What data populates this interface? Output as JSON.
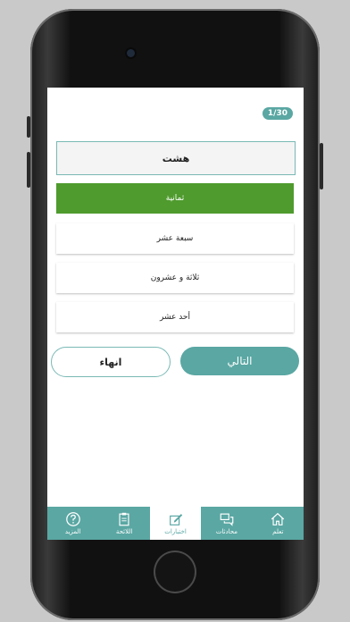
{
  "quiz": {
    "counter": "1/30",
    "question": "هشت",
    "options": [
      {
        "label": "ثمانية",
        "state": "correct"
      },
      {
        "label": "سبعة عشر",
        "state": "default"
      },
      {
        "label": "ثلاثة و عشرون",
        "state": "default"
      },
      {
        "label": "أحد عشر",
        "state": "default"
      }
    ]
  },
  "actions": {
    "finish_label": "انهاء",
    "next_label": "التالي"
  },
  "tabs": [
    {
      "label": "المزيد",
      "icon": "question-icon",
      "active": false
    },
    {
      "label": "اللائحة",
      "icon": "clipboard-icon",
      "active": false
    },
    {
      "label": "اختبارات",
      "icon": "edit-icon",
      "active": true
    },
    {
      "label": "محادثات",
      "icon": "chat-icon",
      "active": false
    },
    {
      "label": "تعلم",
      "icon": "home-icon",
      "active": false
    }
  ],
  "colors": {
    "accent": "#5aa7a3",
    "correct": "#4f9b2e"
  }
}
